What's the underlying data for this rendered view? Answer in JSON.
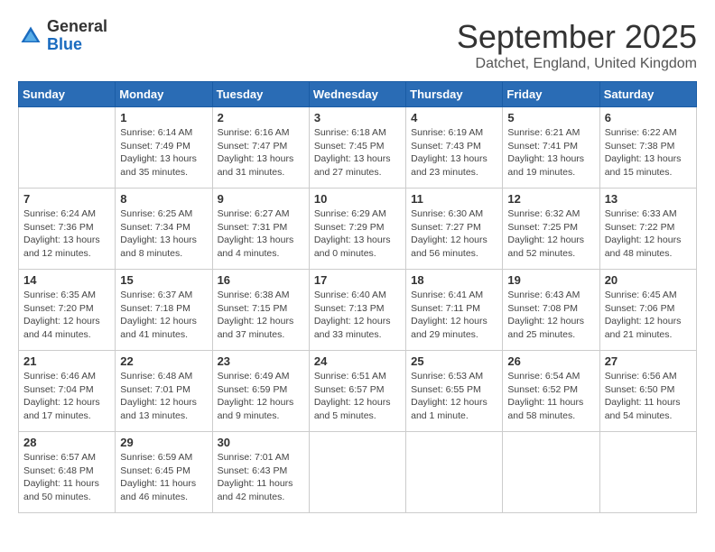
{
  "logo": {
    "general": "General",
    "blue": "Blue"
  },
  "header": {
    "month_title": "September 2025",
    "location": "Datchet, England, United Kingdom"
  },
  "days_of_week": [
    "Sunday",
    "Monday",
    "Tuesday",
    "Wednesday",
    "Thursday",
    "Friday",
    "Saturday"
  ],
  "weeks": [
    [
      {
        "day": "",
        "info": ""
      },
      {
        "day": "1",
        "info": "Sunrise: 6:14 AM\nSunset: 7:49 PM\nDaylight: 13 hours\nand 35 minutes."
      },
      {
        "day": "2",
        "info": "Sunrise: 6:16 AM\nSunset: 7:47 PM\nDaylight: 13 hours\nand 31 minutes."
      },
      {
        "day": "3",
        "info": "Sunrise: 6:18 AM\nSunset: 7:45 PM\nDaylight: 13 hours\nand 27 minutes."
      },
      {
        "day": "4",
        "info": "Sunrise: 6:19 AM\nSunset: 7:43 PM\nDaylight: 13 hours\nand 23 minutes."
      },
      {
        "day": "5",
        "info": "Sunrise: 6:21 AM\nSunset: 7:41 PM\nDaylight: 13 hours\nand 19 minutes."
      },
      {
        "day": "6",
        "info": "Sunrise: 6:22 AM\nSunset: 7:38 PM\nDaylight: 13 hours\nand 15 minutes."
      }
    ],
    [
      {
        "day": "7",
        "info": "Sunrise: 6:24 AM\nSunset: 7:36 PM\nDaylight: 13 hours\nand 12 minutes."
      },
      {
        "day": "8",
        "info": "Sunrise: 6:25 AM\nSunset: 7:34 PM\nDaylight: 13 hours\nand 8 minutes."
      },
      {
        "day": "9",
        "info": "Sunrise: 6:27 AM\nSunset: 7:31 PM\nDaylight: 13 hours\nand 4 minutes."
      },
      {
        "day": "10",
        "info": "Sunrise: 6:29 AM\nSunset: 7:29 PM\nDaylight: 13 hours\nand 0 minutes."
      },
      {
        "day": "11",
        "info": "Sunrise: 6:30 AM\nSunset: 7:27 PM\nDaylight: 12 hours\nand 56 minutes."
      },
      {
        "day": "12",
        "info": "Sunrise: 6:32 AM\nSunset: 7:25 PM\nDaylight: 12 hours\nand 52 minutes."
      },
      {
        "day": "13",
        "info": "Sunrise: 6:33 AM\nSunset: 7:22 PM\nDaylight: 12 hours\nand 48 minutes."
      }
    ],
    [
      {
        "day": "14",
        "info": "Sunrise: 6:35 AM\nSunset: 7:20 PM\nDaylight: 12 hours\nand 44 minutes."
      },
      {
        "day": "15",
        "info": "Sunrise: 6:37 AM\nSunset: 7:18 PM\nDaylight: 12 hours\nand 41 minutes."
      },
      {
        "day": "16",
        "info": "Sunrise: 6:38 AM\nSunset: 7:15 PM\nDaylight: 12 hours\nand 37 minutes."
      },
      {
        "day": "17",
        "info": "Sunrise: 6:40 AM\nSunset: 7:13 PM\nDaylight: 12 hours\nand 33 minutes."
      },
      {
        "day": "18",
        "info": "Sunrise: 6:41 AM\nSunset: 7:11 PM\nDaylight: 12 hours\nand 29 minutes."
      },
      {
        "day": "19",
        "info": "Sunrise: 6:43 AM\nSunset: 7:08 PM\nDaylight: 12 hours\nand 25 minutes."
      },
      {
        "day": "20",
        "info": "Sunrise: 6:45 AM\nSunset: 7:06 PM\nDaylight: 12 hours\nand 21 minutes."
      }
    ],
    [
      {
        "day": "21",
        "info": "Sunrise: 6:46 AM\nSunset: 7:04 PM\nDaylight: 12 hours\nand 17 minutes."
      },
      {
        "day": "22",
        "info": "Sunrise: 6:48 AM\nSunset: 7:01 PM\nDaylight: 12 hours\nand 13 minutes."
      },
      {
        "day": "23",
        "info": "Sunrise: 6:49 AM\nSunset: 6:59 PM\nDaylight: 12 hours\nand 9 minutes."
      },
      {
        "day": "24",
        "info": "Sunrise: 6:51 AM\nSunset: 6:57 PM\nDaylight: 12 hours\nand 5 minutes."
      },
      {
        "day": "25",
        "info": "Sunrise: 6:53 AM\nSunset: 6:55 PM\nDaylight: 12 hours\nand 1 minute."
      },
      {
        "day": "26",
        "info": "Sunrise: 6:54 AM\nSunset: 6:52 PM\nDaylight: 11 hours\nand 58 minutes."
      },
      {
        "day": "27",
        "info": "Sunrise: 6:56 AM\nSunset: 6:50 PM\nDaylight: 11 hours\nand 54 minutes."
      }
    ],
    [
      {
        "day": "28",
        "info": "Sunrise: 6:57 AM\nSunset: 6:48 PM\nDaylight: 11 hours\nand 50 minutes."
      },
      {
        "day": "29",
        "info": "Sunrise: 6:59 AM\nSunset: 6:45 PM\nDaylight: 11 hours\nand 46 minutes."
      },
      {
        "day": "30",
        "info": "Sunrise: 7:01 AM\nSunset: 6:43 PM\nDaylight: 11 hours\nand 42 minutes."
      },
      {
        "day": "",
        "info": ""
      },
      {
        "day": "",
        "info": ""
      },
      {
        "day": "",
        "info": ""
      },
      {
        "day": "",
        "info": ""
      }
    ]
  ]
}
